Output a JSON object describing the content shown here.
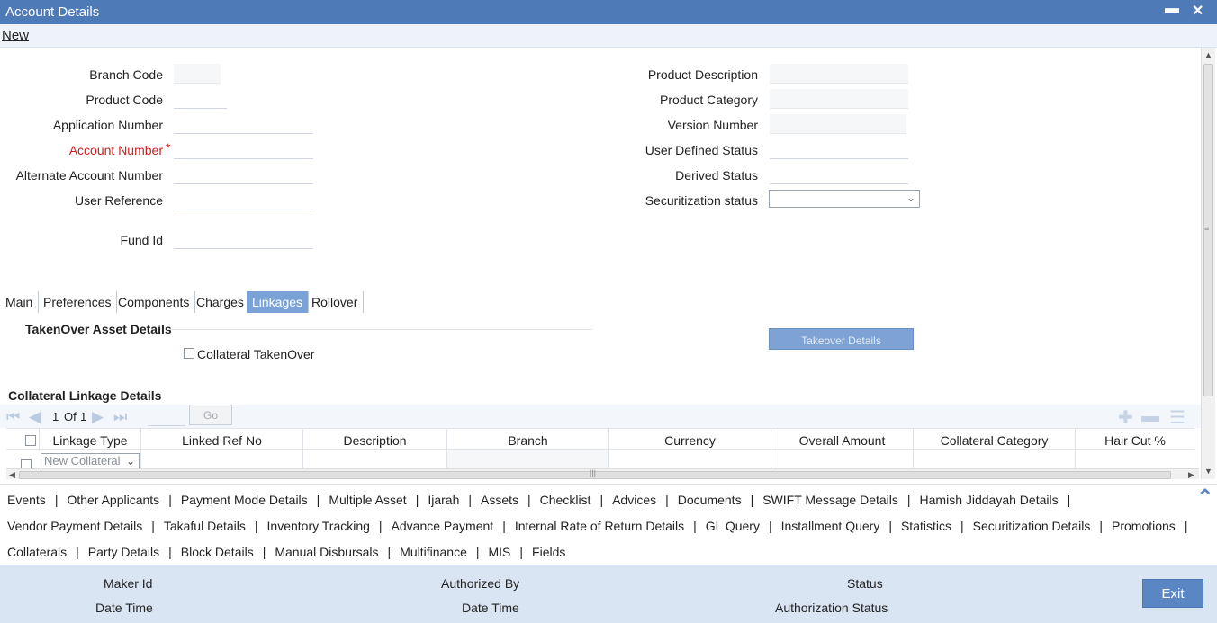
{
  "window": {
    "title": "Account Details",
    "minimize_glyph": "▬",
    "close_glyph": "✕"
  },
  "menubar": {
    "new_label": "New"
  },
  "form": {
    "left": {
      "branch_code": {
        "label": "Branch Code",
        "value": ""
      },
      "product_code": {
        "label": "Product Code",
        "value": ""
      },
      "application_number": {
        "label": "Application Number",
        "value": ""
      },
      "account_number": {
        "label": "Account Number",
        "value": "",
        "required": "*"
      },
      "alternate_account_number": {
        "label": "Alternate Account Number",
        "value": ""
      },
      "user_reference": {
        "label": "User Reference",
        "value": ""
      },
      "fund_id": {
        "label": "Fund Id",
        "value": ""
      }
    },
    "right": {
      "product_description": {
        "label": "Product Description",
        "value": ""
      },
      "product_category": {
        "label": "Product Category",
        "value": ""
      },
      "version_number": {
        "label": "Version Number",
        "value": ""
      },
      "user_defined_status": {
        "label": "User Defined Status",
        "value": ""
      },
      "derived_status": {
        "label": "Derived Status",
        "value": ""
      },
      "securitization_status": {
        "label": "Securitization status",
        "value": ""
      }
    }
  },
  "tabs": [
    {
      "label": "Main",
      "active": false
    },
    {
      "label": "Preferences",
      "active": false
    },
    {
      "label": "Components",
      "active": false
    },
    {
      "label": "Charges",
      "active": false
    },
    {
      "label": "Linkages",
      "active": true
    },
    {
      "label": "Rollover",
      "active": false
    }
  ],
  "takeover": {
    "section_title": "TakenOver Asset Details",
    "checkbox_label": "Collateral TakenOver",
    "checkbox_checked": false,
    "button_label": "Takeover Details"
  },
  "collateral": {
    "section_title": "Collateral Linkage Details",
    "pager": {
      "current": "1",
      "of_label": "Of",
      "total": "1",
      "go_label": "Go"
    },
    "columns": [
      "Linkage Type",
      "Linked Ref No",
      "Description",
      "Branch",
      "Currency",
      "Overall Amount",
      "Collateral Category",
      "Hair Cut %"
    ],
    "rows": [
      {
        "linkage_type": "New Collateral",
        "linked_ref_no": "",
        "description": "",
        "branch": "",
        "currency": "",
        "overall_amount": "",
        "collateral_category": "",
        "hair_cut": ""
      }
    ]
  },
  "links": {
    "row1": [
      "Events",
      "Other Applicants",
      "Payment Mode Details",
      "Multiple Asset",
      "Ijarah",
      "Assets",
      "Checklist",
      "Advices",
      "Documents",
      "SWIFT Message Details",
      "Hamish Jiddayah Details"
    ],
    "row2": [
      "Vendor Payment Details",
      "Takaful Details",
      "Inventory Tracking",
      "Advance Payment",
      "Internal Rate of Return Details",
      "GL Query",
      "Installment Query",
      "Statistics",
      "Securitization Details",
      "Promotions"
    ],
    "row3": [
      "Collaterals",
      "Party Details",
      "Block Details",
      "Manual Disbursals",
      "Multifinance",
      "MIS",
      "Fields"
    ],
    "separator": "|"
  },
  "footer": {
    "maker_id": "Maker Id",
    "date_time_1": "Date Time",
    "authorized_by": "Authorized By",
    "date_time_2": "Date Time",
    "status": "Status",
    "authorization_status": "Authorization Status",
    "exit_label": "Exit"
  },
  "colors": {
    "titlebar": "#4f7ab8",
    "active_tab": "#7aa2d6",
    "footer_bg": "#d9e5f3",
    "exit_button": "#5a86c4",
    "required": "#cc1f1f"
  }
}
